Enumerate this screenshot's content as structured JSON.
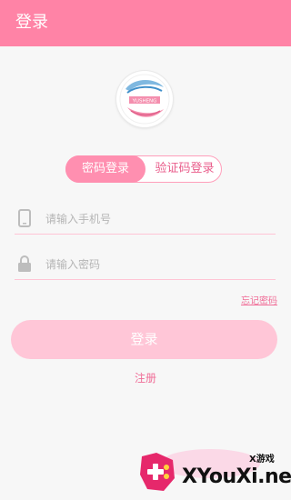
{
  "header": {
    "title": "登录"
  },
  "logo": {
    "text": "YUSHENG"
  },
  "tabs": [
    {
      "label": "密码登录",
      "active": true
    },
    {
      "label": "验证码登录",
      "active": false
    }
  ],
  "form": {
    "phone": {
      "placeholder": "请输入手机号",
      "value": "",
      "icon": "phone-icon"
    },
    "password": {
      "placeholder": "请输入密码",
      "value": "",
      "icon": "lock-icon"
    }
  },
  "links": {
    "forgot_password": "忘记密码",
    "register": "注册"
  },
  "buttons": {
    "login": "登录"
  },
  "watermark": {
    "brand_small": "X游戏",
    "brand_big": "XYouXi.net"
  },
  "colors": {
    "accent": "#ff83a6",
    "tab_active": "#ff8fb0",
    "button": "#ffc6d7",
    "link": "#f06d97"
  }
}
